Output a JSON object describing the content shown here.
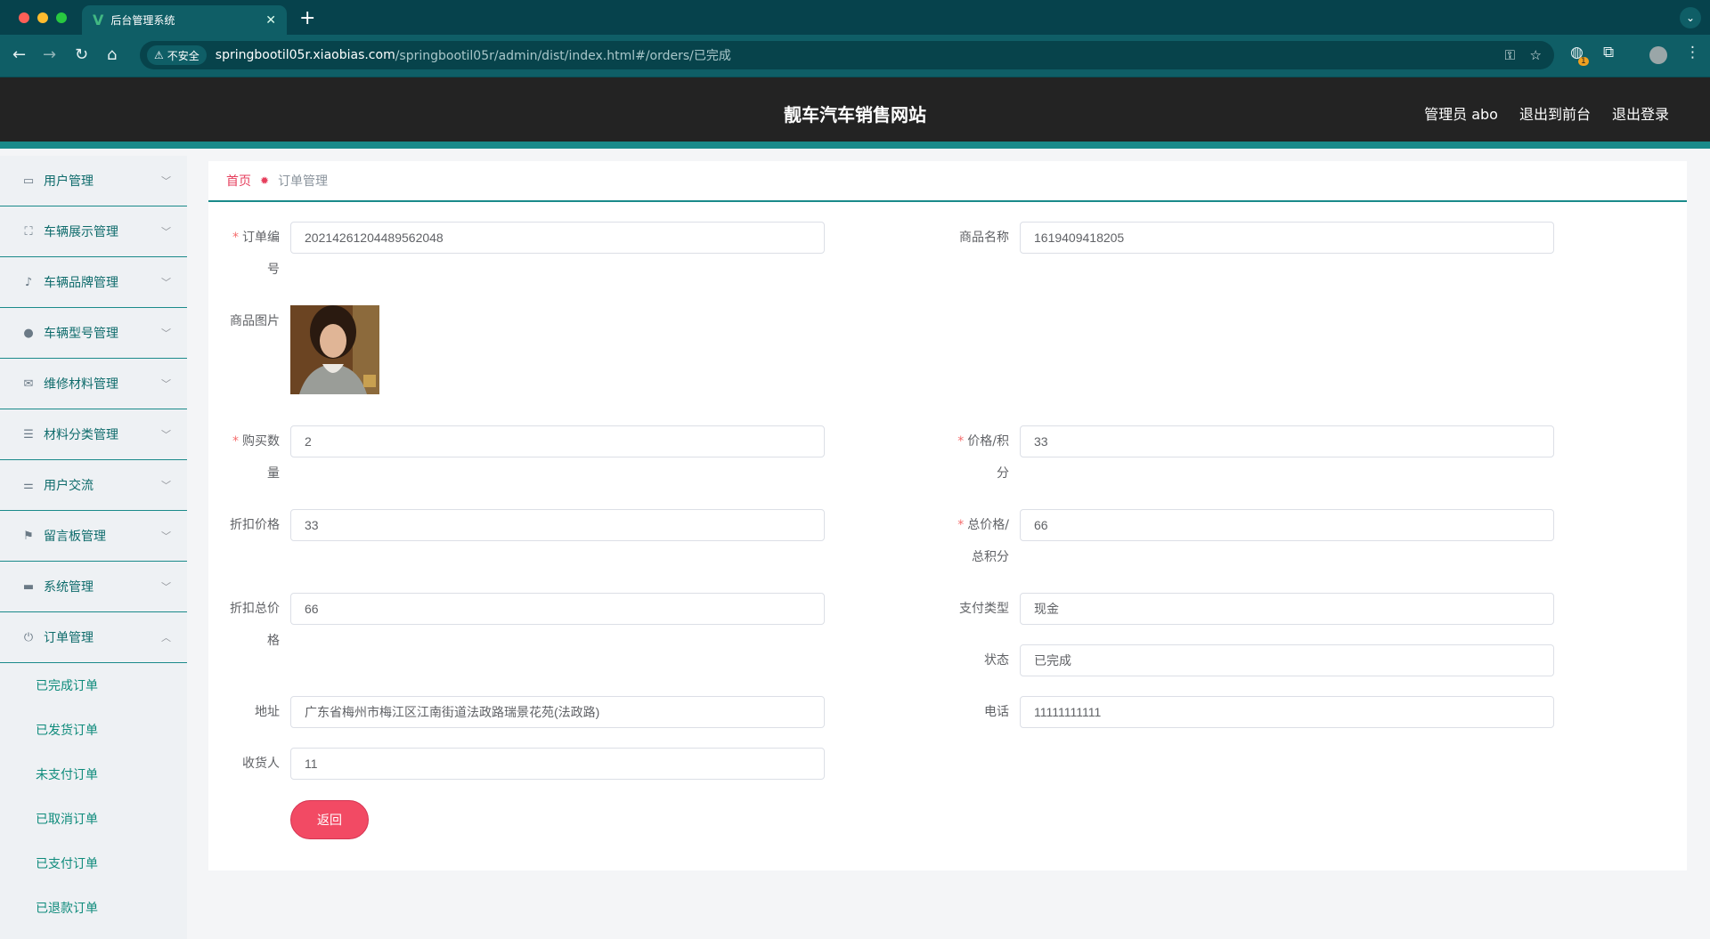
{
  "browser": {
    "tab_title": "后台管理系统",
    "security_label": "不安全",
    "url_host": "springbootil05r.xiaobias.com",
    "url_path": "/springbootil05r/admin/dist/index.html#/orders/已完成",
    "extension_badge": "1",
    "colors": {
      "frame": "#06424c",
      "toolbar": "#0f5e66"
    }
  },
  "header": {
    "title": "靓车汽车销售网站",
    "user_label": "管理员 abo",
    "to_front_label": "退出到前台",
    "logout_label": "退出登录",
    "colors": {
      "bg": "#232323",
      "accent": "#1a8a8a"
    }
  },
  "sidebar": {
    "items": [
      {
        "label": "用户管理",
        "icon": "chat-icon"
      },
      {
        "label": "车辆展示管理",
        "icon": "fullscreen-icon"
      },
      {
        "label": "车辆品牌管理",
        "icon": "bell-off-icon"
      },
      {
        "label": "车辆型号管理",
        "icon": "balloon-icon"
      },
      {
        "label": "维修材料管理",
        "icon": "mail-icon"
      },
      {
        "label": "材料分类管理",
        "icon": "list-icon"
      },
      {
        "label": "用户交流",
        "icon": "sliders-icon"
      },
      {
        "label": "留言板管理",
        "icon": "flag-icon"
      },
      {
        "label": "系统管理",
        "icon": "brush-icon"
      },
      {
        "label": "订单管理",
        "icon": "power-icon",
        "expanded": true
      }
    ],
    "order_submenu": [
      "已完成订单",
      "已发货订单",
      "未支付订单",
      "已取消订单",
      "已支付订单",
      "已退款订单"
    ]
  },
  "breadcrumb": {
    "home": "首页",
    "current": "订单管理"
  },
  "form": {
    "order_no": {
      "label": "订单编号",
      "value": "20214261204489562048",
      "required": true
    },
    "product_name": {
      "label": "商品名称",
      "value": "1619409418205"
    },
    "product_image": {
      "label": "商品图片"
    },
    "quantity": {
      "label": "购买数量",
      "value": "2",
      "required": true
    },
    "price_points": {
      "label": "价格/积分",
      "value": "33",
      "required": true
    },
    "discount_price": {
      "label": "折扣价格",
      "value": "33"
    },
    "total_price_points": {
      "label": "总价格/总积分",
      "value": "66",
      "required": true
    },
    "discount_total": {
      "label": "折扣总价格",
      "value": "66"
    },
    "payment_type": {
      "label": "支付类型",
      "value": "现金"
    },
    "status": {
      "label": "状态",
      "value": "已完成"
    },
    "address": {
      "label": "地址",
      "value": "广东省梅州市梅江区江南街道法政路瑞景花苑(法政路)"
    },
    "phone": {
      "label": "电话",
      "value": "11111111111"
    },
    "receiver": {
      "label": "收货人",
      "value": "11"
    },
    "back_button": "返回"
  }
}
